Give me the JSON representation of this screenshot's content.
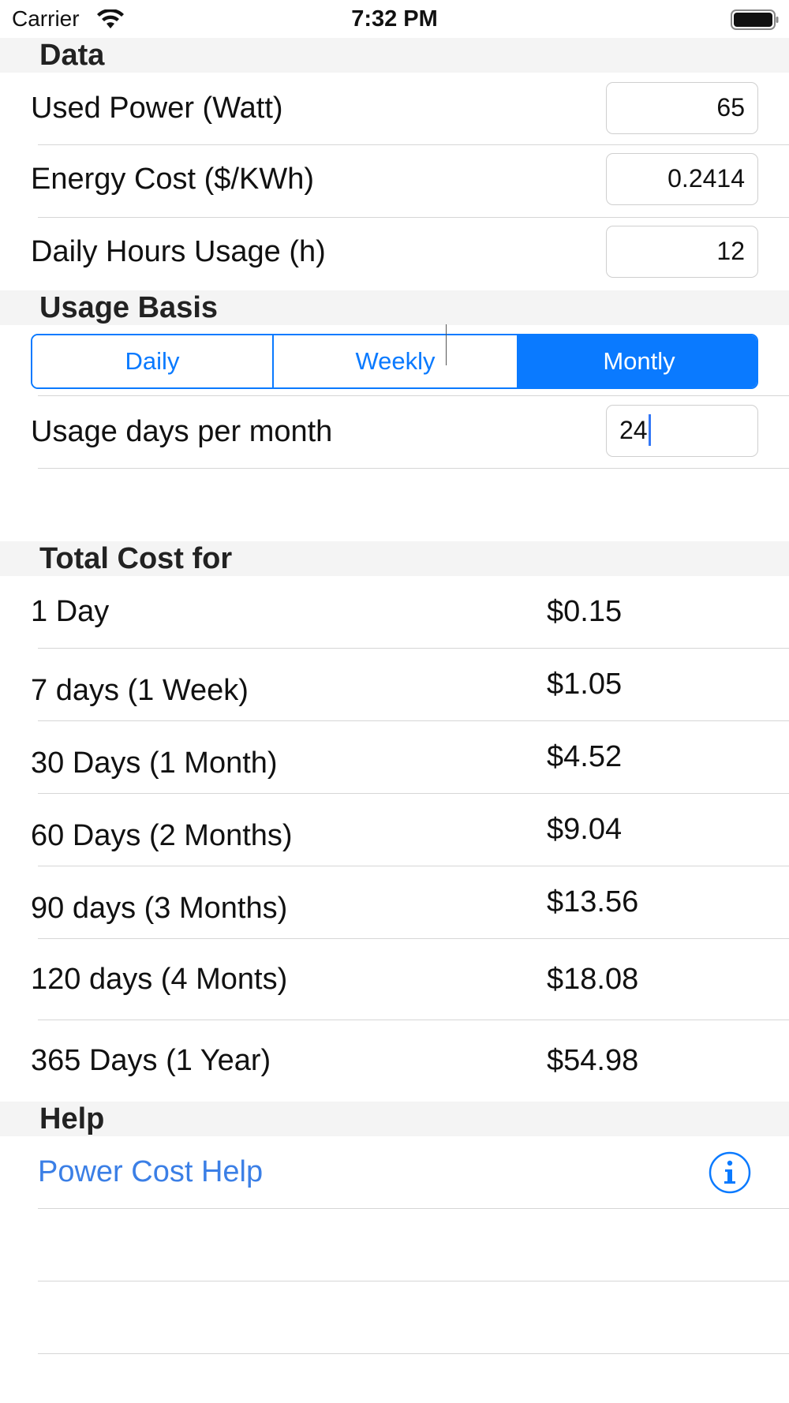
{
  "status_bar": {
    "carrier": "Carrier",
    "time": "7:32 PM"
  },
  "sections": {
    "data": "Data",
    "usage_basis": "Usage Basis",
    "total_cost": "Total Cost for",
    "help": "Help"
  },
  "data_fields": {
    "used_power_label": "Used Power (Watt)",
    "used_power_value": "65",
    "energy_cost_label": "Energy Cost ($/KWh)",
    "energy_cost_value": "0.2414",
    "daily_hours_label": "Daily Hours Usage (h)",
    "daily_hours_value": "12"
  },
  "usage_basis": {
    "segments": [
      "Daily",
      "Weekly",
      "Montly"
    ],
    "selected": "Montly",
    "days_per_month_label": "Usage days per month",
    "days_per_month_value": "24"
  },
  "costs": [
    {
      "label": "1 Day",
      "value": "$0.15"
    },
    {
      "label": "7 days (1 Week)",
      "value": "$1.05"
    },
    {
      "label": "30 Days (1 Month)",
      "value": "$4.52"
    },
    {
      "label": "60 Days (2 Months)",
      "value": "$9.04"
    },
    {
      "label": "90 days (3 Months)",
      "value": "$13.56"
    },
    {
      "label": "120 days (4 Monts)",
      "value": "$18.08"
    },
    {
      "label": "365 Days (1 Year)",
      "value": "$54.98"
    }
  ],
  "help": {
    "link_label": "Power Cost Help",
    "icon": "info-icon"
  },
  "colors": {
    "accent": "#0a7aff",
    "link": "#3b7fe6",
    "header_bg": "#f4f4f4"
  }
}
